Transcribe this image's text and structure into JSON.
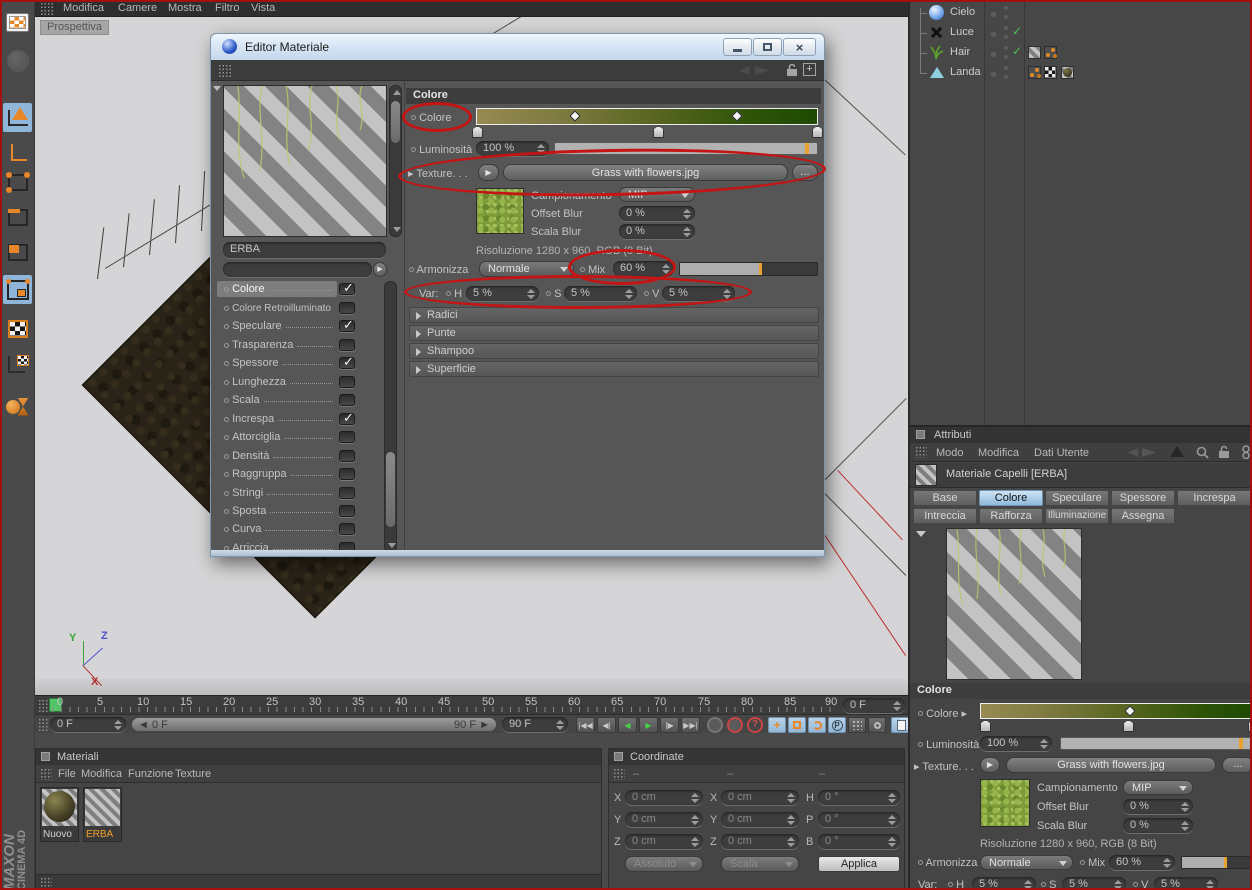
{
  "ui": {
    "accent_orange": "#f09e2c",
    "annotation_red": "#c41414",
    "check_green": "#49c24f",
    "tab_blue": "#8fb9dc"
  },
  "menubar": {
    "items": [
      "Modifica",
      "Camere",
      "Mostra",
      "Filtro",
      "Vista"
    ]
  },
  "viewport": {
    "label": "Prospettiva",
    "axis_x": "X",
    "axis_y": "Y",
    "axis_z": "Z"
  },
  "dialog": {
    "title": "Editor Materiale",
    "name_value": "ERBA",
    "channels": [
      {
        "label": "Colore",
        "checked": true,
        "selected": true
      },
      {
        "label": "Colore Retroilluminato",
        "checked": false
      },
      {
        "label": "Speculare",
        "checked": true
      },
      {
        "label": "Trasparenza",
        "checked": false
      },
      {
        "label": "Spessore",
        "checked": true
      },
      {
        "label": "Lunghezza",
        "checked": false
      },
      {
        "label": "Scala",
        "checked": false
      },
      {
        "label": "Increspa",
        "checked": true
      },
      {
        "label": "Attorciglia",
        "checked": false
      },
      {
        "label": "Densità",
        "checked": false
      },
      {
        "label": "Raggruppa",
        "checked": false
      },
      {
        "label": "Stringi",
        "checked": false
      },
      {
        "label": "Sposta",
        "checked": false
      },
      {
        "label": "Curva",
        "checked": false
      },
      {
        "label": "Arriccia",
        "checked": false
      }
    ]
  },
  "color_panel": {
    "header": "Colore",
    "colore_label": "Colore",
    "luminosita_label": "Luminosità",
    "luminosita_value": "100 %",
    "texture_label": "Texture. . .",
    "texture_file": "Grass with flowers.jpg",
    "texture_browse": "...",
    "campionamento_label": "Campionamento",
    "campionamento_value": "MIP",
    "offset_blur_label": "Offset Blur",
    "offset_blur_value": "0 %",
    "scala_blur_label": "Scala Blur",
    "scala_blur_value": "0 %",
    "risoluzione": "Risoluzione 1280 x 960, RGB (8 Bit)",
    "armonizza_label": "Armonizza",
    "armonizza_value": "Normale",
    "mix_label": "Mix",
    "mix_value": "60 %",
    "var_label": "Var:",
    "h_label": "H",
    "h_value": "5 %",
    "s_label": "S",
    "s_value": "5 %",
    "v_label": "V",
    "v_value": "5 %",
    "sections": [
      "Radici",
      "Punte",
      "Shampoo",
      "Superficie"
    ]
  },
  "objects": {
    "items": [
      {
        "name": "Cielo",
        "check": false
      },
      {
        "name": "Luce",
        "check": true
      },
      {
        "name": "Hair",
        "check": true
      },
      {
        "name": "Landa",
        "check": false
      }
    ]
  },
  "attributes": {
    "title": "Attributi",
    "menu": [
      "Modo",
      "Modifica",
      "Dati Utente"
    ],
    "object_title": "Materiale Capelli [ERBA]",
    "tabs_row1": [
      {
        "label": "Base",
        "selected": false
      },
      {
        "label": "Colore",
        "selected": true
      },
      {
        "label": "Speculare",
        "selected": false
      },
      {
        "label": "Spessore",
        "selected": false
      },
      {
        "label": "Increspa",
        "selected": false
      }
    ],
    "tabs_row2": [
      {
        "label": "Intreccia",
        "selected": false
      },
      {
        "label": "Rafforza",
        "selected": false
      },
      {
        "label": "Illuminazione",
        "selected": false
      },
      {
        "label": "Assegna",
        "selected": false
      }
    ]
  },
  "timeline": {
    "ticks": [
      "0",
      "5",
      "10",
      "15",
      "20",
      "25",
      "30",
      "35",
      "40",
      "45",
      "50",
      "55",
      "60",
      "65",
      "70",
      "75",
      "80",
      "85",
      "90"
    ],
    "frame_value": "0 F",
    "range_start": "0 F",
    "range_end": "90 F",
    "end_value": "90 F",
    "right_value": "0 F"
  },
  "materials": {
    "title": "Materiali",
    "menu": [
      "File",
      "Modifica",
      "Funzione",
      "Texture"
    ],
    "items": [
      {
        "label": "Nuovo"
      },
      {
        "label": "ERBA"
      }
    ]
  },
  "coordinates": {
    "title": "Coordinate",
    "header_dashes": [
      "–",
      "–",
      "–"
    ],
    "rows": [
      {
        "l1": "X",
        "v1": "0 cm",
        "l2": "X",
        "v2": "0 cm",
        "l3": "H",
        "v3": "0 °"
      },
      {
        "l1": "Y",
        "v1": "0 cm",
        "l2": "Y",
        "v2": "0 cm",
        "l3": "P",
        "v3": "0 °"
      },
      {
        "l1": "Z",
        "v1": "0 cm",
        "l2": "Z",
        "v2": "0 cm",
        "l3": "B",
        "v3": "0 °"
      }
    ],
    "mode1": "Assoluto",
    "mode2": "Scala",
    "apply": "Applica"
  },
  "branding": {
    "line1": "MAXON",
    "line2": "CINEMA 4D"
  }
}
